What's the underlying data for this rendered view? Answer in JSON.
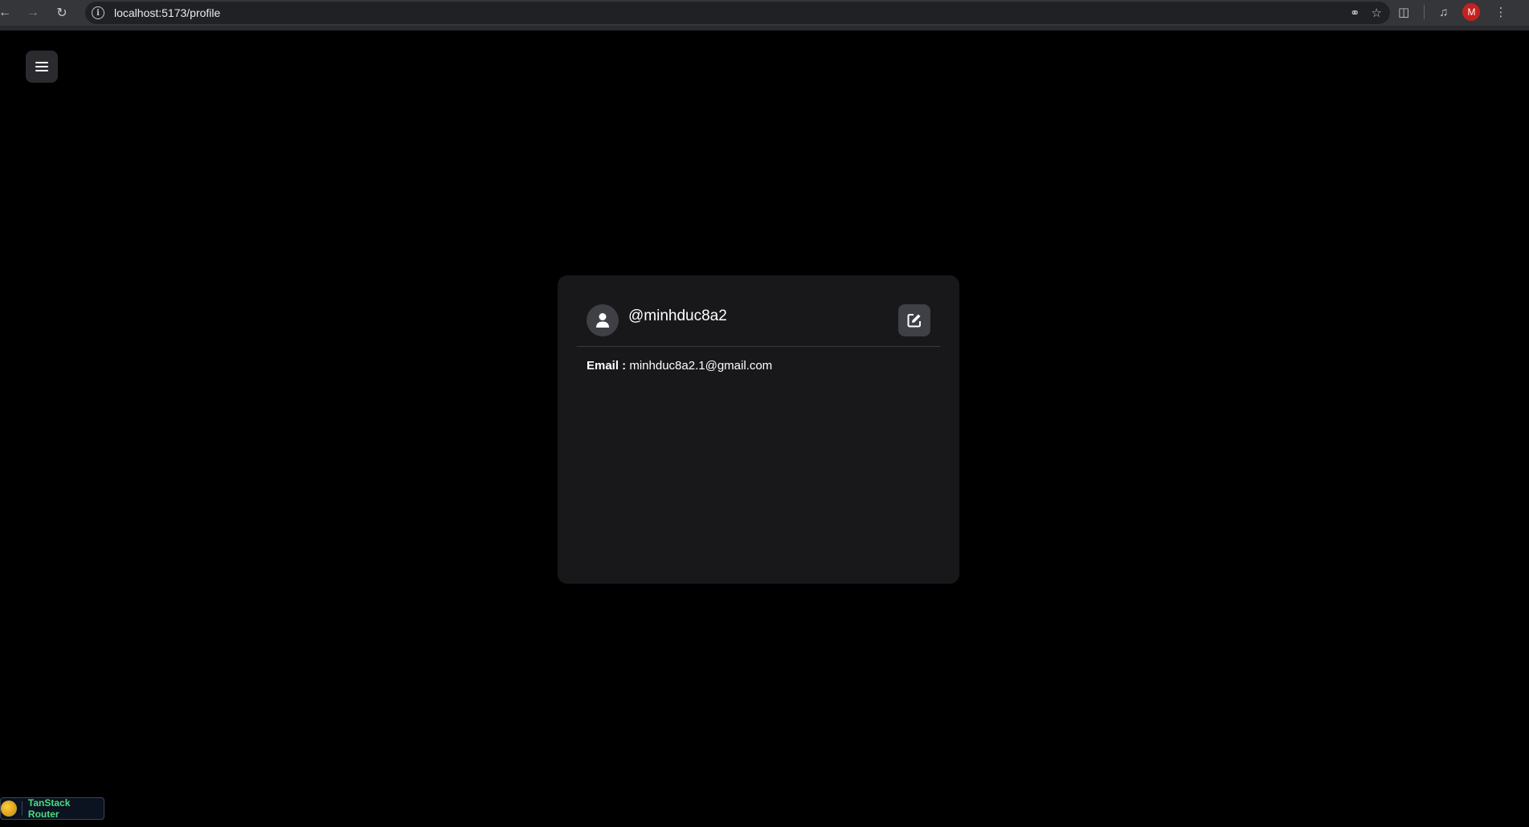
{
  "browser": {
    "url": "localhost:5173/profile",
    "back_icon": "arrow-left-icon",
    "forward_icon": "arrow-right-icon",
    "reload_icon": "reload-icon",
    "profile_initial": "M"
  },
  "page": {
    "menu_icon": "hamburger-menu-icon"
  },
  "profile": {
    "username": "@minhduc8a2",
    "email_label": "Email :",
    "email_value": "minhduc8a2.1@gmail.com"
  },
  "devtools": {
    "label": "TanStack Router"
  },
  "colors": {
    "background": "#000000",
    "card": "#18181b",
    "button": "#3f3f46",
    "devtools_text": "#4ade80",
    "avatar_red": "#c5221f"
  }
}
